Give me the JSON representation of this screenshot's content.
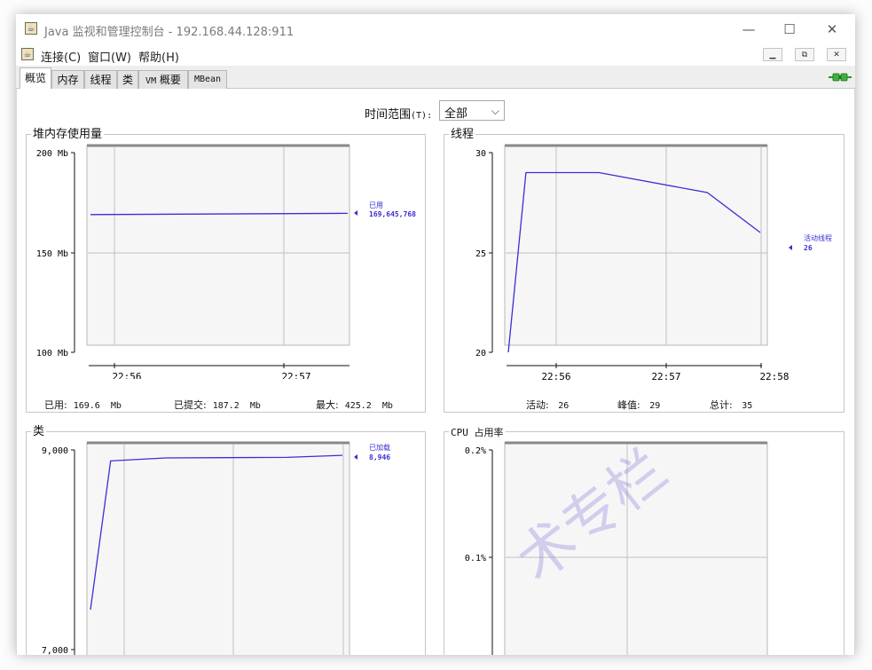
{
  "window": {
    "title": "Java 监视和管理控制台 - 192.168.44.128:911",
    "controls": {
      "minimize": "—",
      "maximize": "☐",
      "close": "✕"
    }
  },
  "menubar": {
    "items": [
      "连接(C)",
      "窗口(W)",
      "帮助(H)"
    ],
    "mdi_controls": [
      "▁",
      "⧉",
      "✕"
    ]
  },
  "tabs": [
    {
      "label": "概览",
      "active": true
    },
    {
      "label": "内存",
      "active": false
    },
    {
      "label": "线程",
      "active": false
    },
    {
      "label": "类",
      "active": false
    },
    {
      "label_prefix": "VM",
      "label": "概要",
      "active": false
    },
    {
      "label": "MBean",
      "active": false
    }
  ],
  "connection_icon": "connected-plug-icon",
  "time_range": {
    "label": "时间范围",
    "shortcut": "(T):",
    "selected": "全部",
    "chevron": "⌵"
  },
  "colors": {
    "series": "#3a2ed6",
    "grid": "#c0c0c0",
    "plot_bg": "#f6f6f6"
  },
  "panels": {
    "heap": {
      "title": "堆内存使用量",
      "footer": [
        {
          "label": "已用:",
          "value": "169.6  Mb"
        },
        {
          "label": "已提交:",
          "value": "187.2  Mb"
        },
        {
          "label": "最大:",
          "value": "425.2  Mb"
        }
      ],
      "legend": {
        "name": "已用",
        "value": "169,645,768"
      }
    },
    "threads": {
      "title": "线程",
      "footer": [
        {
          "label": "活动:",
          "value": "26"
        },
        {
          "label": "峰值:",
          "value": "29"
        },
        {
          "label": "总计:",
          "value": "35"
        }
      ],
      "legend": {
        "name": "活动线程",
        "value": "26"
      }
    },
    "classes": {
      "title": "类",
      "legend": {
        "name": "已加载",
        "value": "8,946"
      }
    },
    "cpu": {
      "title": "CPU 占用率"
    }
  },
  "chart_data": [
    {
      "type": "line",
      "title": "堆内存使用量",
      "y_ticks": [
        "200 Mb",
        "150 Mb",
        "100 Mb"
      ],
      "x_ticks": [
        "22:56",
        "22:57"
      ],
      "ylim": [
        100,
        200
      ],
      "x_range": [
        0,
        1
      ],
      "tick_x": [
        0.1,
        0.75
      ],
      "series": [
        {
          "name": "已用",
          "x": [
            0,
            1
          ],
          "y": [
            169,
            169.6
          ]
        }
      ]
    },
    {
      "type": "line",
      "title": "线程",
      "y_ticks": [
        "30",
        "25",
        "20"
      ],
      "x_ticks": [
        "22:56",
        "22:57",
        "22:58"
      ],
      "ylim": [
        20,
        30
      ],
      "x_range": [
        0,
        1
      ],
      "tick_x": [
        0.18,
        0.6,
        1.0
      ],
      "series": [
        {
          "name": "活动线程",
          "x": [
            0,
            0.07,
            0.36,
            0.79,
            1
          ],
          "y": [
            20,
            29,
            29,
            28,
            26
          ]
        }
      ]
    },
    {
      "type": "line",
      "title": "类",
      "y_ticks": [
        "9,000",
        "7,000"
      ],
      "x_ticks": [],
      "ylim": [
        7000,
        9000
      ],
      "x_range": [
        0,
        1
      ],
      "tick_x": [],
      "series": [
        {
          "name": "已加载",
          "x": [
            0,
            0.08,
            0.3,
            0.78,
            1
          ],
          "y": [
            7400,
            8890,
            8920,
            8925,
            8946
          ]
        }
      ]
    },
    {
      "type": "line",
      "title": "CPU 占用率",
      "y_ticks": [
        "0.2%",
        "0.1%"
      ],
      "x_ticks": [],
      "ylim": [
        0,
        0.2
      ],
      "series": []
    }
  ],
  "watermark": "术专栏"
}
